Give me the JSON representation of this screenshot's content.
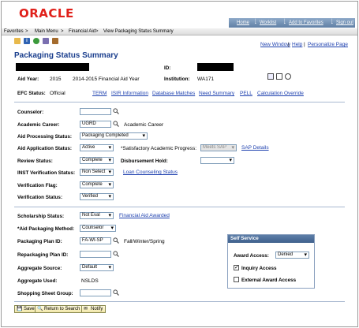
{
  "brand": {
    "logo_text": "ORACLE",
    "logo_color": "#e0201a"
  },
  "header_links": [
    "Home",
    "Worklist",
    "Add to Favorites",
    "Sign out"
  ],
  "nav": {
    "items": [
      "Favorites",
      "Main Menu",
      "Financial Aid",
      "View Packaging Status Summary"
    ],
    "separator": ">"
  },
  "toolbar": {
    "new_window": "New Window",
    "help": "Help",
    "personalize": "Personalize Page"
  },
  "page": {
    "title": "Packaging Status Summary",
    "id_label": "ID:",
    "aid_year_label": "Aid Year:",
    "aid_year_value": "2015",
    "aid_year_desc": "2014-2015 Financial Aid Year",
    "institution_label": "Institution:",
    "institution_value": "WA171"
  },
  "efc": {
    "label": "EFC Status:",
    "value": "Official",
    "links": [
      "TERM",
      "ISIR Information",
      "Database Matches",
      "Need Summary",
      "PELL",
      "Calculation Override"
    ]
  },
  "form": {
    "counselor_label": "Counselor:",
    "counselor_value": "",
    "career_label": "Academic Career:",
    "career_value": "UGRD",
    "career_desc": "Academic Career",
    "processing_label": "Aid Processing Status:",
    "processing_value": "Packaging Completed",
    "application_label": "Aid Application Status:",
    "application_value": "Active",
    "sap_label": "*Satisfactory Academic Progress:",
    "sap_value": "Meets SAP",
    "sap_link": "SAP Details",
    "review_label": "Review Status:",
    "review_value": "Complete",
    "disbursement_label": "Disbursement Hold:",
    "disbursement_value": "",
    "inst_label": "INST Verification Status:",
    "inst_value": "Non Select",
    "loan_link": "Loan Counseling Status",
    "verif_flag_label": "Verification Flag:",
    "verif_flag_value": "Complete",
    "verif_status_label": "Verification Status:",
    "verif_status_value": "Verified"
  },
  "packaging": {
    "scholarship_label": "Scholarship Status:",
    "scholarship_value": "Not Eval",
    "awarded_link": "Financial Aid Awarded",
    "method_label": "*Aid Packaging Method:",
    "method_value": "Counselor",
    "plan_label": "Packaging Plan ID:",
    "plan_value": "FA-WI-SP",
    "plan_desc": "Fall/Winter/Spring",
    "repack_label": "Repackaging Plan ID:",
    "repack_value": "",
    "source_label": "Aggregate Source:",
    "source_value": "Default",
    "used_label": "Aggregate Used:",
    "used_value": "NSLDS",
    "sheet_label": "Shopping Sheet Group:",
    "sheet_value": ""
  },
  "self_service": {
    "title": "Self Service",
    "award_access_label": "Award Access:",
    "award_access_value": "Denied",
    "inquiry_label": "Inquiry Access",
    "inquiry_checked": true,
    "external_label": "External Award Access",
    "external_checked": false
  },
  "buttons": {
    "save": "Save",
    "return": "Return to Search",
    "notify": "Notify"
  }
}
